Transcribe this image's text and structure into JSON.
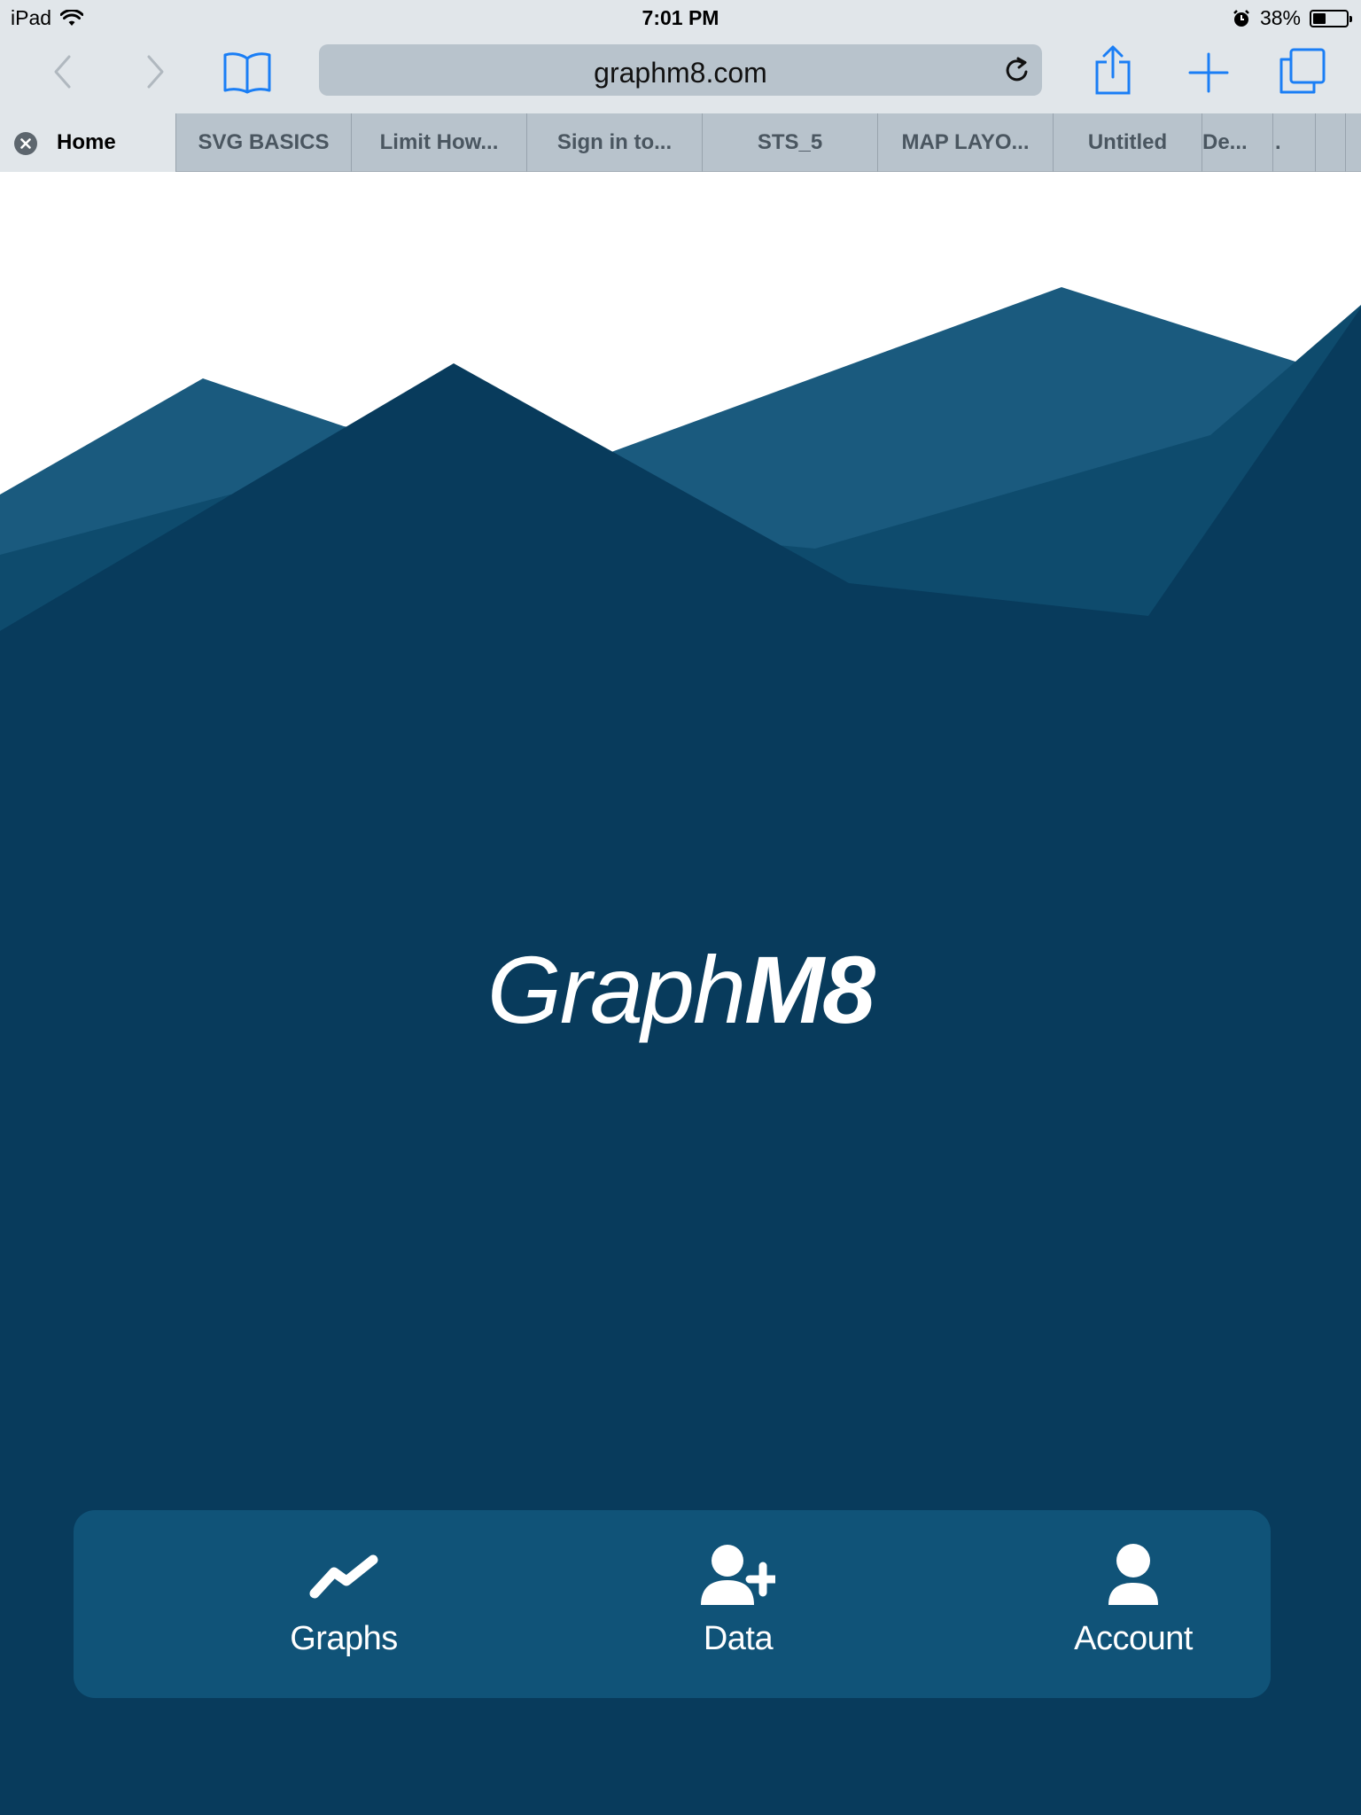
{
  "status_bar": {
    "device": "iPad",
    "time": "7:01 PM",
    "battery_percent_label": "38%",
    "battery_level": 0.38
  },
  "toolbar": {
    "url": "graphm8.com",
    "icons": [
      "back-icon",
      "forward-icon",
      "bookmarks-icon",
      "reload-icon",
      "share-icon",
      "new-tab-icon",
      "tabs-icon"
    ],
    "accent_color": "#1a7ef5"
  },
  "tabs": [
    {
      "label": "Home",
      "active": true
    },
    {
      "label": "SVG BASICS"
    },
    {
      "label": "Limit How..."
    },
    {
      "label": "Sign in to..."
    },
    {
      "label": "STS_5"
    },
    {
      "label": "MAP LAYO..."
    },
    {
      "label": "Untitled"
    },
    {
      "label": "De..."
    },
    {
      "label": "."
    },
    {
      "label": ""
    }
  ],
  "page": {
    "logo_light": "Graph",
    "logo_bold": "M8",
    "background_color": "#083b5c",
    "nav": [
      {
        "label": "Graphs",
        "icon": "graph-line-icon"
      },
      {
        "label": "Data",
        "icon": "add-user-icon"
      },
      {
        "label": "Account",
        "icon": "user-icon"
      }
    ]
  }
}
